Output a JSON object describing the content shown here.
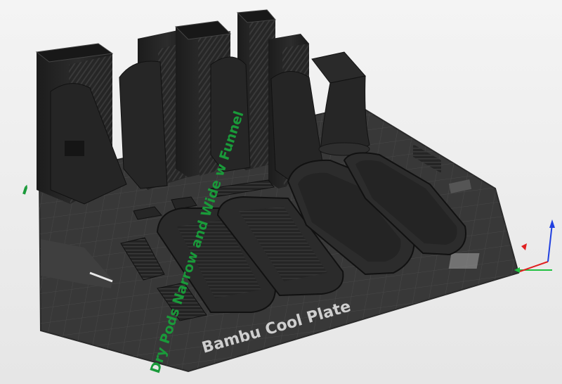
{
  "plate": {
    "label": "Bambu Cool Plate",
    "name_label": "Dry Pods Narrow and Wide w Funnel",
    "edit_icon": "pencil-icon"
  },
  "colors": {
    "plate": "#3a3a3a",
    "model": "#222222",
    "plate_text": "#cfcfcf",
    "name_text": "#1a9a3a",
    "axis_x": "#e02020",
    "axis_y": "#20c040",
    "axis_z": "#2040e0"
  }
}
